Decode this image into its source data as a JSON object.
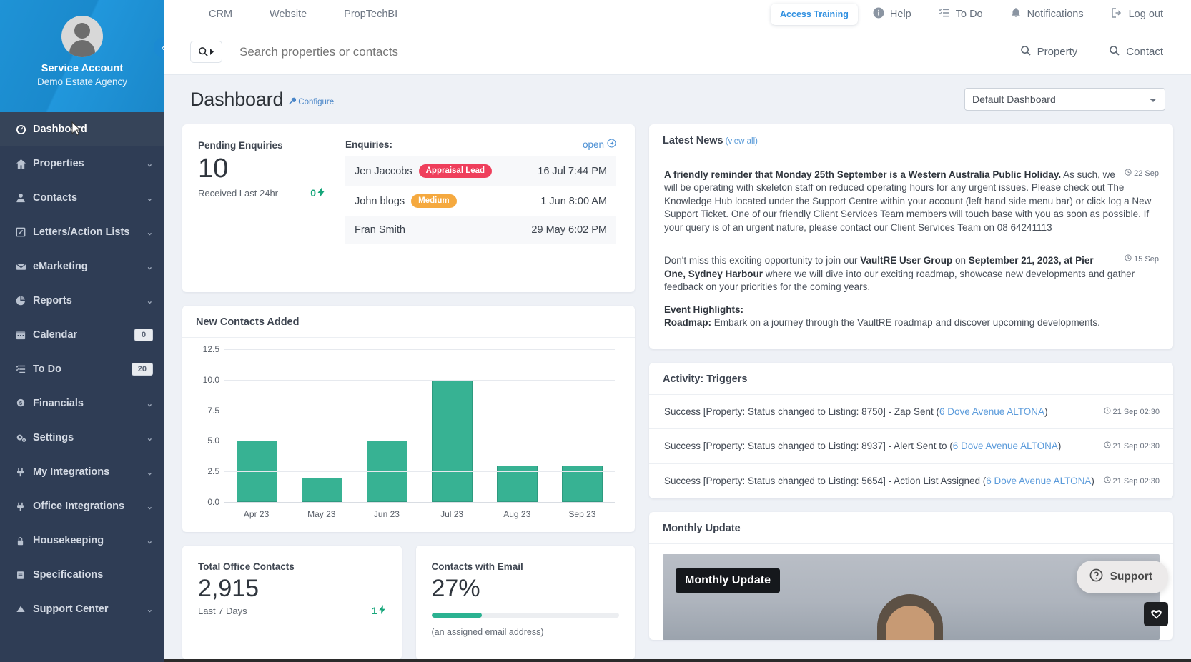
{
  "sidebar": {
    "profile": {
      "name": "Service Account",
      "org": "Demo Estate Agency",
      "avatar_icon": "user-avatar-icon"
    },
    "collapse_icon": "«",
    "items": [
      {
        "label": "Dashboard",
        "icon": "gauge-icon",
        "active": true,
        "caret": false,
        "badge": null
      },
      {
        "label": "Properties",
        "icon": "home-icon",
        "active": false,
        "caret": true,
        "badge": null
      },
      {
        "label": "Contacts",
        "icon": "person-icon",
        "active": false,
        "caret": true,
        "badge": null
      },
      {
        "label": "Letters/Action Lists",
        "icon": "edit-square-icon",
        "active": false,
        "caret": true,
        "badge": null
      },
      {
        "label": "eMarketing",
        "icon": "envelope-icon",
        "active": false,
        "caret": true,
        "badge": null
      },
      {
        "label": "Reports",
        "icon": "pie-chart-icon",
        "active": false,
        "caret": true,
        "badge": null
      },
      {
        "label": "Calendar",
        "icon": "calendar-icon",
        "active": false,
        "caret": false,
        "badge": "0"
      },
      {
        "label": "To Do",
        "icon": "checklist-icon",
        "active": false,
        "caret": false,
        "badge": "20"
      },
      {
        "label": "Financials",
        "icon": "dollar-badge-icon",
        "active": false,
        "caret": true,
        "badge": null
      },
      {
        "label": "Settings",
        "icon": "gears-icon",
        "active": false,
        "caret": true,
        "badge": null
      },
      {
        "label": "My Integrations",
        "icon": "plug-icon",
        "active": false,
        "caret": true,
        "badge": null
      },
      {
        "label": "Office Integrations",
        "icon": "plug-icon",
        "active": false,
        "caret": true,
        "badge": null
      },
      {
        "label": "Housekeeping",
        "icon": "lock-icon",
        "active": false,
        "caret": true,
        "badge": null
      },
      {
        "label": "Specifications",
        "icon": "book-icon",
        "active": false,
        "caret": false,
        "badge": null
      },
      {
        "label": "Support Center",
        "icon": "lifebuoy-icon",
        "active": false,
        "caret": true,
        "badge": null
      }
    ]
  },
  "topbar": {
    "nav": [
      {
        "label": "CRM"
      },
      {
        "label": "Website"
      },
      {
        "label": "PropTechBI"
      }
    ],
    "access_training": "Access Training",
    "right_links": [
      {
        "label": "Help",
        "icon": "info-circle-icon"
      },
      {
        "label": "To Do",
        "icon": "checklist-icon"
      },
      {
        "label": "Notifications",
        "icon": "bell-icon"
      },
      {
        "label": "Log out",
        "icon": "logout-icon"
      }
    ]
  },
  "search": {
    "placeholder": "Search properties or contacts",
    "value": "",
    "button_icon": "search-caret-icon",
    "shortcuts": [
      {
        "label": "Property",
        "icon": "search-icon"
      },
      {
        "label": "Contact",
        "icon": "search-icon"
      }
    ]
  },
  "page": {
    "title": "Dashboard",
    "configure": "Configure",
    "configure_icon": "wrench-icon",
    "dashboard_select": {
      "value": "Default Dashboard",
      "options": [
        "Default Dashboard"
      ]
    }
  },
  "pending_enquiries": {
    "label": "Pending Enquiries",
    "count": "10",
    "sub": "Received Last 24hr",
    "delta": "0",
    "delta_icon": "bolt-icon"
  },
  "enquiries": {
    "title": "Enquiries:",
    "open_label": "open",
    "open_icon": "arrow-circle-right-icon",
    "rows": [
      {
        "name": "Jen Jaccobs",
        "tag": "Appraisal Lead",
        "tag_color": "#ef3f5c",
        "time": "16 Jul 7:44 PM"
      },
      {
        "name": "John blogs",
        "tag": "Medium",
        "tag_color": "#f5a93f",
        "time": "1 Jun 8:00 AM"
      },
      {
        "name": "Fran Smith",
        "tag": "",
        "tag_color": "",
        "time": "29 May 6:02 PM"
      }
    ]
  },
  "chart_data": {
    "type": "bar",
    "title": "New Contacts Added",
    "categories": [
      "Apr 23",
      "May 23",
      "Jun 23",
      "Jul 23",
      "Aug 23",
      "Sep 23"
    ],
    "values": [
      5,
      2,
      5,
      10,
      3,
      3
    ],
    "yticks": [
      "0.0",
      "2.5",
      "5.0",
      "7.5",
      "10.0",
      "12.5"
    ],
    "ylim": [
      0,
      12.5
    ],
    "xlabel": "",
    "ylabel": "",
    "grid": true,
    "legend": "none",
    "bar_color": "#37b293"
  },
  "total_office_contacts": {
    "label": "Total Office Contacts",
    "value": "2,915",
    "sub": "Last 7 Days",
    "delta": "1",
    "delta_icon": "bolt-icon"
  },
  "contacts_with_email": {
    "label": "Contacts with Email",
    "value": "27%",
    "percent": 27,
    "note": "(an assigned email address)"
  },
  "latest_news": {
    "title": "Latest News",
    "view_all": "(view all)",
    "items": [
      {
        "date": "22 Sep",
        "heading": "A friendly reminder that Monday 25th September is a Western Australia Public Holiday.",
        "lines": [
          "As such, we will be operating with skeleton staff on reduced operating hours for any urgent issues.",
          "Please check out The Knowledge Hub located under the Support Centre within your account (left hand side menu bar) or click log a New Support Ticket.",
          "One of our friendly Client Services Team members will touch base with you as soon as possible.",
          "If your query is of an urgent nature, please contact our Client Services Team on 08 64241113"
        ]
      },
      {
        "date": "15 Sep",
        "heading": "",
        "lines": [],
        "rich": "Don't miss this exciting opportunity to join our <b>VaultRE User Group</b> on <b>September 21, 2023, at Pier One, Sydney Harbour</b> where we will dive into our exciting roadmap, showcase new developments and gather feedback on your priorities for the coming years.",
        "highlights_title": "Event Highlights:",
        "highlights_rich": "<b>Roadmap:</b> Embark on a journey through the VaultRE roadmap and discover upcoming developments."
      }
    ]
  },
  "activity_triggers": {
    "title": "Activity: Triggers",
    "rows": [
      {
        "prefix": "Success [Property: Status changed to Listing: 8750] - Zap Sent (",
        "link": "6 Dove Avenue ALTONA",
        "suffix": ")",
        "time": "21 Sep 02:30"
      },
      {
        "prefix": "Success [Property: Status changed to Listing: 8937] - Alert Sent to (",
        "link": "6 Dove Avenue ALTONA",
        "suffix": ")",
        "time": "21 Sep 02:30"
      },
      {
        "prefix": "Success [Property: Status changed to Listing: 5654] - Action List Assigned (",
        "link": "6 Dove Avenue ALTONA",
        "suffix": ")",
        "time": "21 Sep 02:30"
      }
    ]
  },
  "monthly_update": {
    "title": "Monthly Update",
    "video_title": "Monthly Update"
  },
  "support_widget": {
    "label": "Support",
    "icon": "question-circle-icon"
  },
  "favourite_button": {
    "icon": "heart-icon"
  },
  "colors": {
    "sidebar_bg": "#2f3d55",
    "sidebar_profile": "#1a8fd4",
    "accent_blue": "#4a86c8",
    "green": "#37b293",
    "red_tag": "#ef3f5c",
    "orange_tag": "#f5a93f",
    "page_bg": "#eef1f6"
  }
}
